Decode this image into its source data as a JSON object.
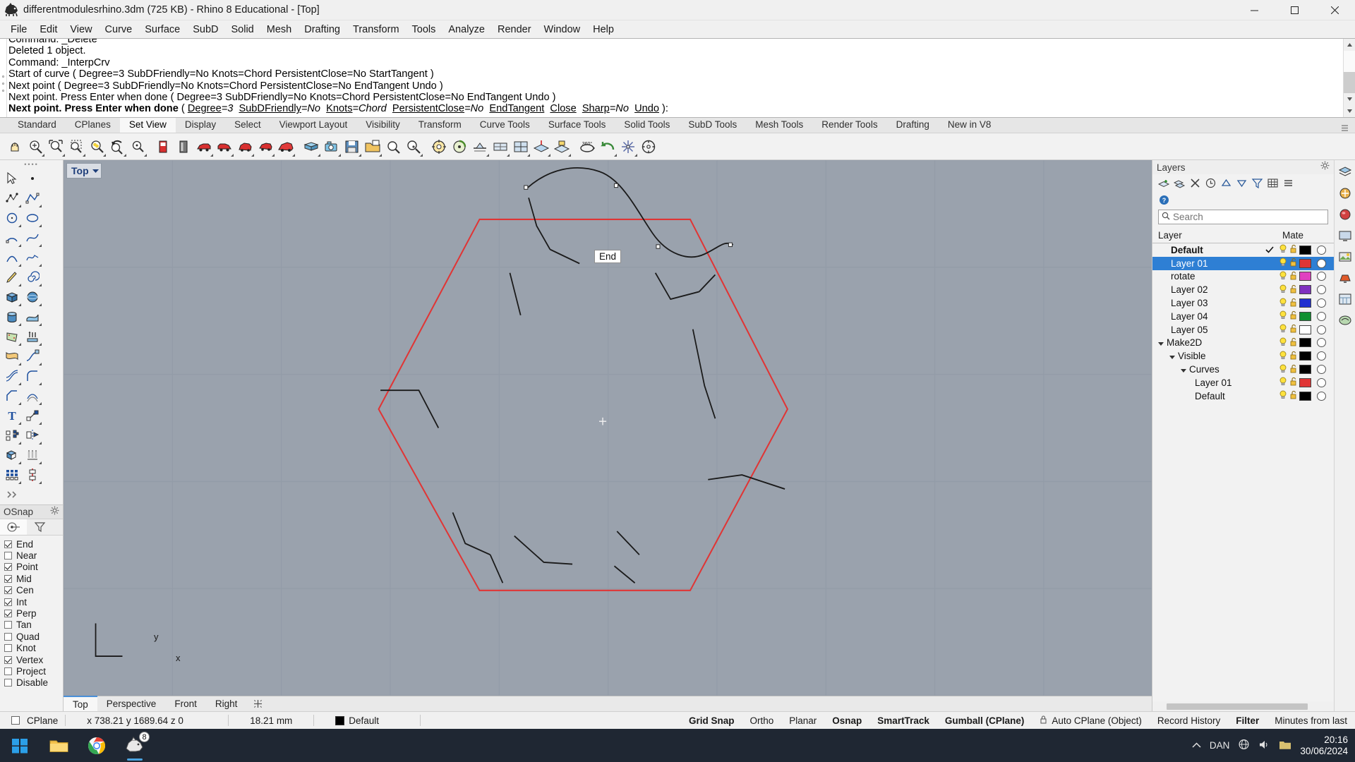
{
  "titlebar": {
    "text": "differentmodulesrhino.3dm (725 KB) - Rhino 8 Educational - [Top]",
    "icon": "rhino-logo-icon",
    "minimize": "minimize-icon",
    "maximize": "maximize-icon",
    "close": "close-icon"
  },
  "menubar": {
    "items": [
      "File",
      "Edit",
      "View",
      "Curve",
      "Surface",
      "SubD",
      "Solid",
      "Mesh",
      "Drafting",
      "Transform",
      "Tools",
      "Analyze",
      "Render",
      "Window",
      "Help"
    ]
  },
  "command_area": {
    "history": [
      "Command: _Delete",
      "Deleted 1 object.",
      "Command: _InterpCrv",
      "Start of curve ( Degree=3  SubDFriendly=No  Knots=Chord  PersistentClose=No  StartTangent )",
      "Next point ( Degree=3  SubDFriendly=No  Knots=Chord  PersistentClose=No  EndTangent  Undo )",
      "Next point. Press Enter when done ( Degree=3  SubDFriendly=No  Knots=Chord  PersistentClose=No  EndTangent  Undo )"
    ],
    "prompt": {
      "bold_text": "Next point. Press Enter when done",
      "options_prefix": " ( ",
      "options": [
        {
          "label": "Degree",
          "value": "=3"
        },
        {
          "label": "SubDFriendly",
          "value": "=No"
        },
        {
          "label": "Knots",
          "value": "=Chord"
        },
        {
          "label": "PersistentClose",
          "value": "=No"
        },
        {
          "label": "EndTangent",
          "value": ""
        },
        {
          "label": "Close",
          "value": ""
        },
        {
          "label": "Sharp",
          "value": "=No"
        },
        {
          "label": "Undo",
          "value": ""
        }
      ],
      "options_suffix": " ):"
    }
  },
  "ribbon_tabs": {
    "items": [
      "Standard",
      "CPlanes",
      "Set View",
      "Display",
      "Select",
      "Viewport Layout",
      "Visibility",
      "Transform",
      "Curve Tools",
      "Surface Tools",
      "Solid Tools",
      "SubD Tools",
      "Mesh Tools",
      "Render Tools",
      "Drafting",
      "New in V8"
    ],
    "active": "Set View"
  },
  "toolbar": {
    "groups": [
      [
        "pan-icon",
        "zoom-extents-icon",
        "zoom-window-icon",
        "zoom-selected-icon",
        "zoom-target-icon",
        "zoom-previous-icon",
        "zoom-dynamic-icon",
        "zoom-1to1-icon"
      ],
      [
        "view-front-icon",
        "view-back-icon",
        "view-right-red-icon",
        "view-left-red-icon",
        "view-top-red-icon",
        "view-bottom-red-icon",
        "view-perspective-red-icon"
      ],
      [
        "camera-set-icon",
        "camera-icon",
        "save-view-icon",
        "named-views-icon",
        "view-search-icon",
        "zoom-lens-icon"
      ],
      [
        "target-icon",
        "rotate-view-icon",
        "tilt-view-icon",
        "plan-view-icon",
        "four-view-icon"
      ],
      [
        "set-cplane-icon",
        "cplane-object-icon",
        "cplane-origin-icon",
        "cplane-elevation-icon",
        "cplane-surface-icon",
        "cplane-curve-icon"
      ],
      [
        "view-360-icon",
        "undo-view-icon",
        "refresh-view-icon",
        "viewport-props-icon"
      ]
    ]
  },
  "left_toolbar": {
    "rows": [
      [
        "select-arrow-icon",
        "point-icon",
        "points-multi-icon"
      ],
      [
        "polyline-icon",
        "circle-icon",
        "ellipse-icon"
      ],
      [
        "arc-icon",
        "curve-icon",
        "conic-icon"
      ],
      [
        "freeform-curve-icon",
        "sketch-icon",
        "spiral-icon"
      ],
      [
        "box-icon",
        "sphere-icon",
        "cylinder-icon"
      ],
      [
        "surface-edge-icon",
        "patch-icon",
        "extrude-icon"
      ],
      [
        "loft-icon",
        "sweep1-icon",
        "sweep2-icon"
      ],
      [
        "fillet-icon",
        "chamfer-icon",
        "offset-icon"
      ],
      [
        "text-icon",
        "move-icon",
        "copy-icon"
      ],
      [
        "mirror-icon",
        "boolean-icon",
        "array-icon"
      ],
      [
        "grid-array-icon",
        "polar-array-icon",
        "more-tools-icon"
      ]
    ]
  },
  "osnap": {
    "title": "OSnap",
    "gear": "gear-icon",
    "tabs": [
      "osnap-tab-icon",
      "filter-tab-icon"
    ],
    "active_tab": 0,
    "items": [
      {
        "label": "End",
        "checked": true
      },
      {
        "label": "Near",
        "checked": false
      },
      {
        "label": "Point",
        "checked": true
      },
      {
        "label": "Mid",
        "checked": true
      },
      {
        "label": "Cen",
        "checked": true
      },
      {
        "label": "Int",
        "checked": true
      },
      {
        "label": "Perp",
        "checked": true
      },
      {
        "label": "Tan",
        "checked": false
      },
      {
        "label": "Quad",
        "checked": false
      },
      {
        "label": "Knot",
        "checked": false
      },
      {
        "label": "Vertex",
        "checked": true
      },
      {
        "label": "Project",
        "checked": false
      },
      {
        "label": "Disable",
        "checked": false
      }
    ]
  },
  "viewport": {
    "label": "Top",
    "dropdown_icon": "chevron-down-icon",
    "tooltip": "End",
    "axis_x_label": "x",
    "axis_y_label": "y",
    "hexagon_color": "#e03535",
    "curve_color": "#1a1a1a",
    "background": "#9aa2ad",
    "grid_color": "#8d96a2",
    "tabs": [
      "Top",
      "Perspective",
      "Front",
      "Right"
    ],
    "active_tab": "Top",
    "add_tab_icon": "add-viewport-icon"
  },
  "layers": {
    "title": "Layers",
    "gear": "gear-icon",
    "toolbar_icons": [
      "new-layer-icon",
      "new-sublayer-icon",
      "delete-layer-icon",
      "undo-layer-icon",
      "move-up-icon",
      "move-down-icon",
      "filter-icon",
      "grid-icon",
      "menu-icon"
    ],
    "help_icon": "help-icon",
    "search_placeholder": "Search",
    "search_icon": "search-icon",
    "search_value": "",
    "columns": [
      "Layer",
      "Mate"
    ],
    "rows": [
      {
        "name": "Default",
        "indent": 0,
        "current": true,
        "bold": true,
        "selected": false,
        "color": "#000000",
        "expander": null
      },
      {
        "name": "Layer 01",
        "indent": 0,
        "current": false,
        "bold": false,
        "selected": true,
        "color": "#e03535",
        "expander": null
      },
      {
        "name": "rotate",
        "indent": 0,
        "current": false,
        "bold": false,
        "selected": false,
        "color": "#e040c0",
        "expander": null
      },
      {
        "name": "Layer 02",
        "indent": 0,
        "current": false,
        "bold": false,
        "selected": false,
        "color": "#8030c0",
        "expander": null
      },
      {
        "name": "Layer 03",
        "indent": 0,
        "current": false,
        "bold": false,
        "selected": false,
        "color": "#2030d0",
        "expander": null
      },
      {
        "name": "Layer 04",
        "indent": 0,
        "current": false,
        "bold": false,
        "selected": false,
        "color": "#109030",
        "expander": null
      },
      {
        "name": "Layer 05",
        "indent": 0,
        "current": false,
        "bold": false,
        "selected": false,
        "color": "#ffffff",
        "expander": null
      },
      {
        "name": "Make2D",
        "indent": 0,
        "current": false,
        "bold": false,
        "selected": false,
        "color": "#000000",
        "expander": "down"
      },
      {
        "name": "Visible",
        "indent": 1,
        "current": false,
        "bold": false,
        "selected": false,
        "color": "#000000",
        "expander": "down"
      },
      {
        "name": "Curves",
        "indent": 2,
        "current": false,
        "bold": false,
        "selected": false,
        "color": "#000000",
        "expander": "down"
      },
      {
        "name": "Layer 01",
        "indent": 3,
        "current": false,
        "bold": false,
        "selected": false,
        "color": "#e03535",
        "expander": null
      },
      {
        "name": "Default",
        "indent": 3,
        "current": false,
        "bold": false,
        "selected": false,
        "color": "#000000",
        "expander": null
      }
    ],
    "row_icons": {
      "bulb": "lightbulb-icon",
      "lock": "unlock-icon"
    }
  },
  "right_rail": {
    "items": [
      "layers-panel-icon",
      "properties-panel-icon",
      "materials-panel-icon",
      "display-panel-icon",
      "render-panel-icon",
      "lights-panel-icon",
      "named-views-panel-icon",
      "help-panel-icon"
    ]
  },
  "statusbar": {
    "cplane_checkbox": "cplane-checkbox",
    "cplane_label": "CPlane",
    "coordinates": "x 738.21  y 1689.64  z 0",
    "units": "18.21 mm",
    "layer_swatch_color": "#000000",
    "layer_name": "Default",
    "toggles": [
      {
        "label": "Grid Snap",
        "on": true
      },
      {
        "label": "Ortho",
        "on": false
      },
      {
        "label": "Planar",
        "on": false
      },
      {
        "label": "Osnap",
        "on": true
      },
      {
        "label": "SmartTrack",
        "on": true
      },
      {
        "label": "Gumball (CPlane)",
        "on": true
      },
      {
        "label": "Auto CPlane (Object)",
        "on": false,
        "icon": "lock-icon"
      },
      {
        "label": "Record History",
        "on": false
      },
      {
        "label": "Filter",
        "on": true
      },
      {
        "label": "Minutes from last",
        "on": false
      }
    ]
  },
  "taskbar": {
    "start_icon": "windows-start-icon",
    "apps": [
      {
        "name": "file-explorer-icon",
        "active": false
      },
      {
        "name": "chrome-icon",
        "active": false
      },
      {
        "name": "rhino-icon",
        "active": true,
        "badge": "8"
      }
    ],
    "tray": {
      "chevron_icon": "show-hidden-icons-icon",
      "label": "DAN",
      "network_icon": "network-icon",
      "volume_icon": "volume-icon",
      "folder_icon": "tray-folder-icon",
      "time": "20:16",
      "date": "30/06/2024"
    }
  }
}
